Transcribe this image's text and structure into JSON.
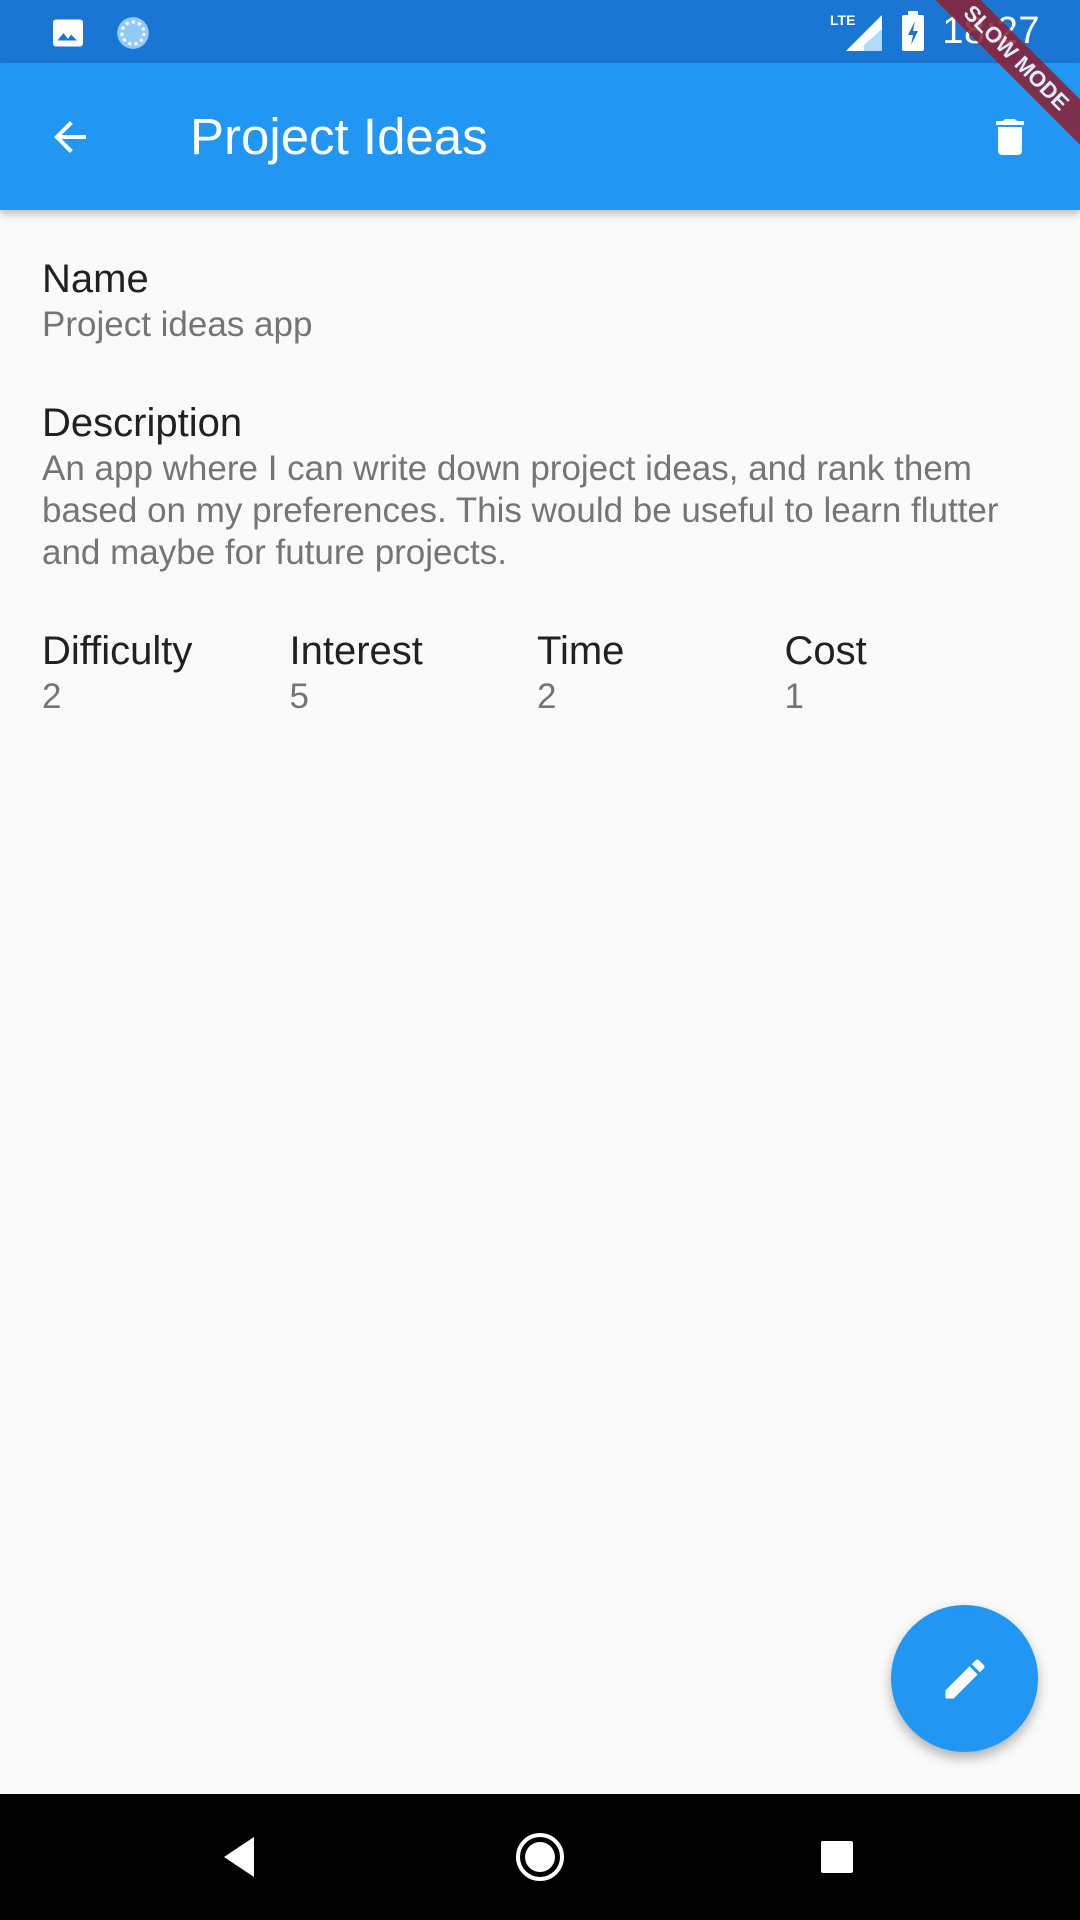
{
  "status_bar": {
    "time": "18:27",
    "network": "LTE",
    "icons": [
      "image-icon",
      "sync-icon",
      "signal-icon",
      "battery-charging-icon"
    ]
  },
  "debug_banner": {
    "text": "SLOW MODE"
  },
  "app_bar": {
    "title": "Project Ideas",
    "back_icon": "arrow-back-icon",
    "delete_icon": "delete-icon"
  },
  "project": {
    "name_label": "Name",
    "name_value": "Project ideas app",
    "description_label": "Description",
    "description_value": "An app where I can write down project ideas, and rank them based on my preferences. This would be useful to learn flutter and maybe for future projects.",
    "stats": [
      {
        "label": "Difficulty",
        "value": "2"
      },
      {
        "label": "Interest",
        "value": "5"
      },
      {
        "label": "Time",
        "value": "2"
      },
      {
        "label": "Cost",
        "value": "1"
      }
    ]
  },
  "fab": {
    "icon": "edit-icon"
  },
  "nav_bar": {
    "buttons": [
      "nav-back-icon",
      "nav-home-icon",
      "nav-recents-icon"
    ]
  },
  "colors": {
    "status_bar": "#1976d2",
    "app_bar": "#2196f3",
    "fab": "#2196f3",
    "background": "#fafafa"
  }
}
